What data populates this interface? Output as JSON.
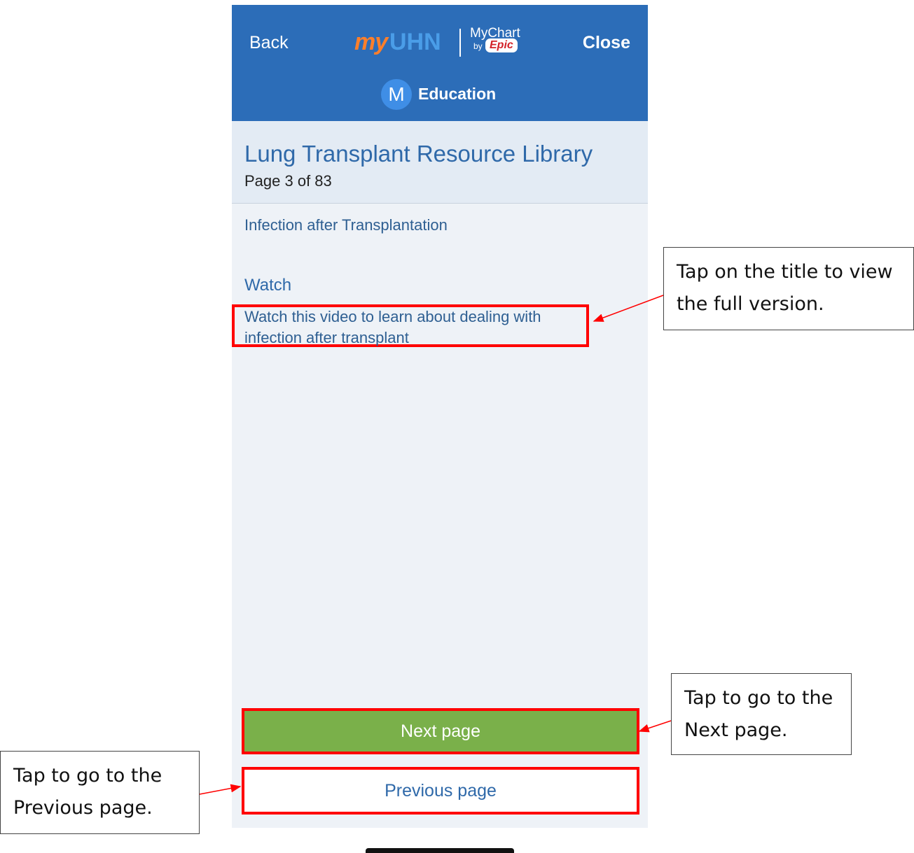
{
  "header": {
    "back_label": "Back",
    "close_label": "Close",
    "logo_my": "my",
    "logo_uhn": "UHN",
    "mychart": "MyChart",
    "by": "by",
    "epic": "Epic",
    "avatar_initial": "M",
    "section": "Education"
  },
  "library": {
    "title": "Lung Transplant Resource Library",
    "page": "Page 3 of 83"
  },
  "content": {
    "topic": "Infection after Transplantation",
    "watch_heading": "Watch",
    "video_link": "Watch this video to learn about dealing with infection after transplant"
  },
  "nav": {
    "next_label": "Next page",
    "prev_label": "Previous page"
  },
  "callouts": {
    "title_tip": "Tap on the title to view the full version.",
    "next_tip": "Tap to go to the Next page.",
    "prev_tip": "Tap to go to the Previous page."
  },
  "colors": {
    "header_bg": "#2c6db8",
    "next_button": "#7ab04a",
    "highlight": "#ff0000"
  }
}
